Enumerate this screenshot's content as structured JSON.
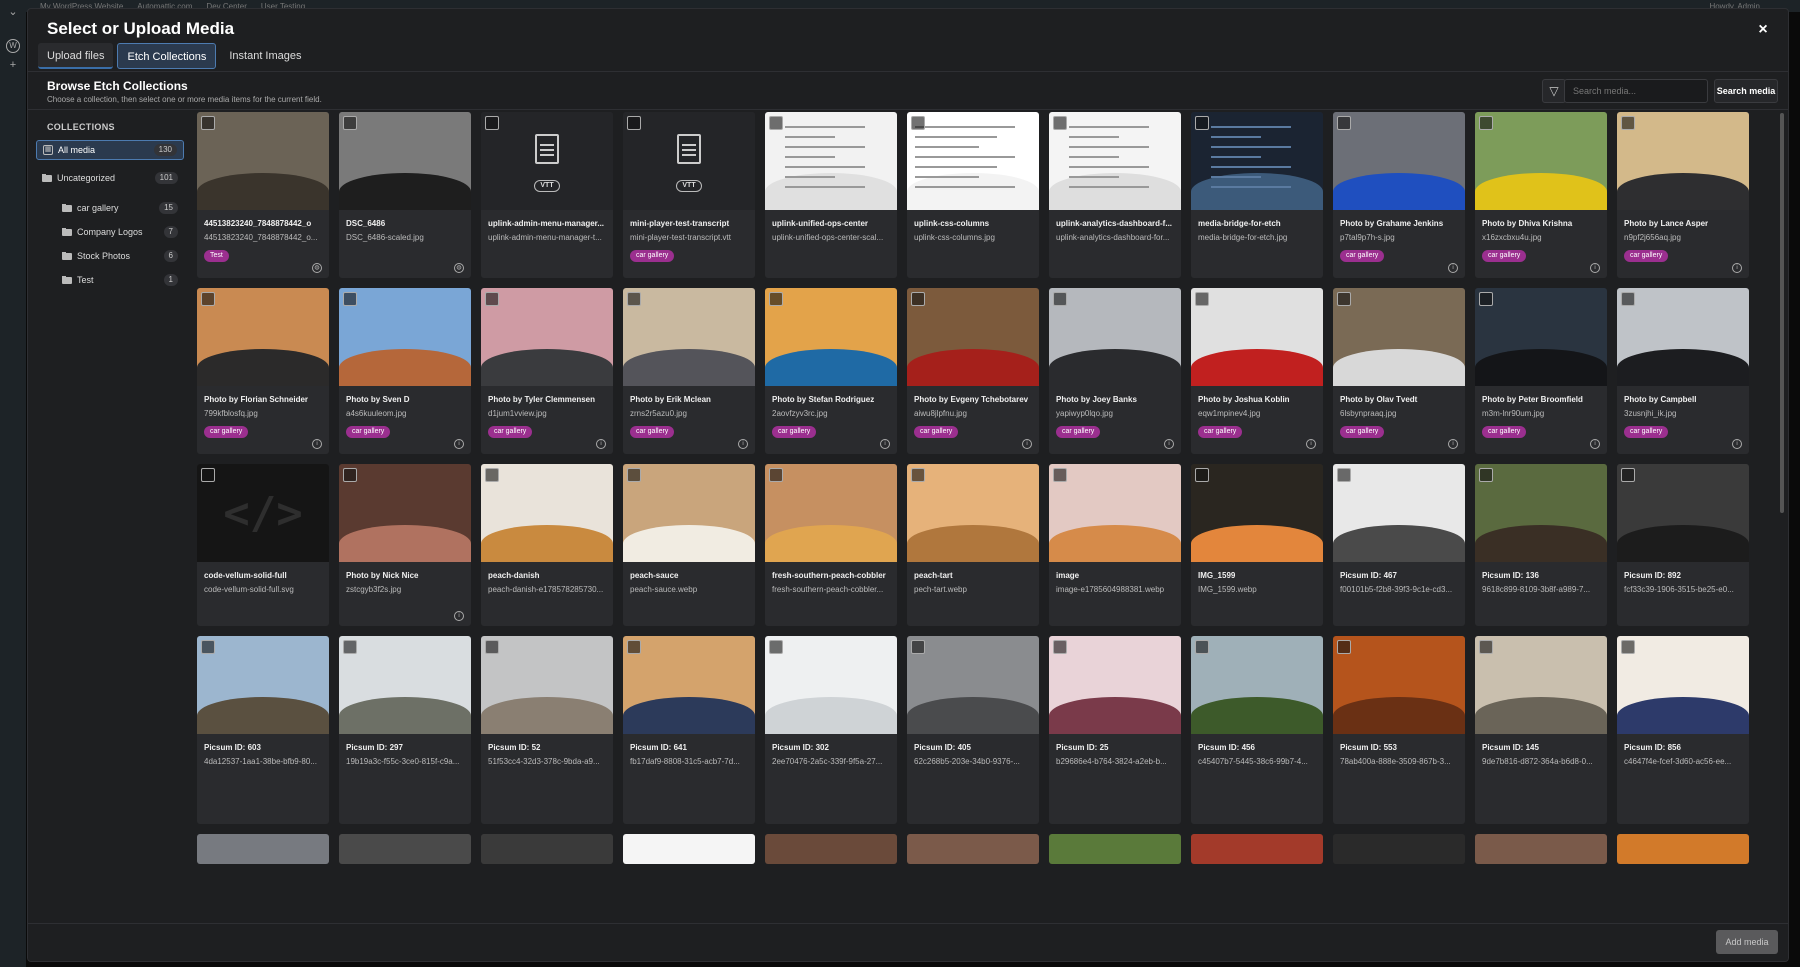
{
  "wp_bar": {
    "left": [
      "My WordPress Website",
      "Automattic.com",
      "Dev Center",
      "User Testing"
    ],
    "right": "Howdy, Admin"
  },
  "modal": {
    "title": "Select or Upload Media",
    "close_label": "×"
  },
  "tabs": [
    {
      "label": "Upload files"
    },
    {
      "label": "Etch Collections"
    },
    {
      "label": "Instant Images"
    }
  ],
  "browse": {
    "title": "Browse Etch Collections",
    "subtitle": "Choose a collection, then select one or more media items for the current field."
  },
  "search": {
    "placeholder": "Search media...",
    "button": "Search media",
    "filter_icon": "filter-icon"
  },
  "collections": {
    "heading": "COLLECTIONS",
    "items": [
      {
        "label": "All media",
        "count": "130",
        "selected": true,
        "sub": false
      },
      {
        "label": "Uncategorized",
        "count": "101",
        "sub": false
      },
      {
        "label": "car gallery",
        "count": "15",
        "sub": true
      },
      {
        "label": "Company Logos",
        "count": "7",
        "sub": true
      },
      {
        "label": "Stock Photos",
        "count": "6",
        "sub": true
      },
      {
        "label": "Test",
        "count": "1",
        "sub": true
      }
    ]
  },
  "media": [
    {
      "name": "44513823240_7848878442_o",
      "file": "44513823240_7848878442_o...",
      "tag": "Test",
      "icon": "globe",
      "c1": "#6b6356",
      "c2": "#3a342c"
    },
    {
      "name": "DSC_6486",
      "file": "DSC_6486-scaled.jpg",
      "icon": "globe",
      "c1": "#7a7a7a",
      "c2": "#1e1e1e"
    },
    {
      "name": "uplink-admin-menu-manager...",
      "file": "uplink-admin-menu-manager-t...",
      "kind": "vtt",
      "vtt": "VTT"
    },
    {
      "name": "mini-player-test-transcript",
      "file": "mini-player-test-transcript.vtt",
      "tag": "car gallery",
      "kind": "vtt",
      "vtt": "VTT"
    },
    {
      "name": "uplink-unified-ops-center",
      "file": "uplink-unified-ops-center-scal...",
      "kind": "ui",
      "c1": "#f2f2f2",
      "c2": "#e0e0e0"
    },
    {
      "name": "uplink-css-columns",
      "file": "uplink-css-columns.jpg",
      "kind": "text",
      "c1": "#ffffff",
      "c2": "#f3f3f3"
    },
    {
      "name": "uplink-analytics-dashboard-f...",
      "file": "uplink-analytics-dashboard-for...",
      "kind": "ui",
      "c1": "#f4f4f4",
      "c2": "#dedede"
    },
    {
      "name": "media-bridge-for-etch",
      "file": "media-bridge-for-etch.jpg",
      "kind": "dark",
      "c1": "#1b2432",
      "c2": "#3c5a7a"
    },
    {
      "name": "Photo by Grahame Jenkins",
      "file": "p7tal9p7h-s.jpg",
      "tag": "car gallery",
      "icon": "info",
      "c1": "#6c6f77",
      "c2": "#1f4fbf"
    },
    {
      "name": "Photo by Dhiva Krishna",
      "file": "x16zxcbxu4u.jpg",
      "tag": "car gallery",
      "icon": "info",
      "c1": "#7d9c5a",
      "c2": "#e0c21a"
    },
    {
      "name": "Photo by Lance Asper",
      "file": "n9pf2j656aq.jpg",
      "tag": "car gallery",
      "icon": "info",
      "c1": "#d3b98a",
      "c2": "#2e2e30"
    },
    {
      "name": "Photo by Florian Schneider",
      "file": "799kfblosfq.jpg",
      "tag": "car gallery",
      "icon": "info",
      "c1": "#c98a52",
      "c2": "#2b2a2a"
    },
    {
      "name": "Photo by Sven D",
      "file": "a4s6kuuleom.jpg",
      "tag": "car gallery",
      "icon": "info",
      "c1": "#7aa6d6",
      "c2": "#b5673a"
    },
    {
      "name": "Photo by Tyler Clemmensen",
      "file": "d1jum1vview.jpg",
      "tag": "car gallery",
      "icon": "info",
      "c1": "#cf9ba4",
      "c2": "#3a3b3e"
    },
    {
      "name": "Photo by Erik Mclean",
      "file": "zrns2r5azu0.jpg",
      "tag": "car gallery",
      "icon": "info",
      "c1": "#c9b9a0",
      "c2": "#54545a"
    },
    {
      "name": "Photo by Stefan Rodriguez",
      "file": "2aovfzyv3rc.jpg",
      "tag": "car gallery",
      "icon": "info",
      "c1": "#e3a34a",
      "c2": "#1f6aa5"
    },
    {
      "name": "Photo by Evgeny Tchebotarev",
      "file": "aiwu8jlpfnu.jpg",
      "tag": "car gallery",
      "icon": "info",
      "c1": "#7c5a3c",
      "c2": "#a5201b"
    },
    {
      "name": "Photo by Joey Banks",
      "file": "yapiwyp0lqo.jpg",
      "tag": "car gallery",
      "icon": "info",
      "c1": "#b5b8bd",
      "c2": "#2a2b2e"
    },
    {
      "name": "Photo by Joshua Koblin",
      "file": "eqw1mpinev4.jpg",
      "tag": "car gallery",
      "icon": "info",
      "c1": "#e0e0e0",
      "c2": "#c1201f"
    },
    {
      "name": "Photo by Olav Tvedt",
      "file": "6lsbynpraaq.jpg",
      "tag": "car gallery",
      "icon": "info",
      "c1": "#7a6a55",
      "c2": "#d8d8d8"
    },
    {
      "name": "Photo by Peter Broomfield",
      "file": "m3m-lnr90um.jpg",
      "tag": "car gallery",
      "icon": "info",
      "c1": "#2a3440",
      "c2": "#141518"
    },
    {
      "name": "Photo by Campbell",
      "file": "3zusnjhi_ik.jpg",
      "tag": "car gallery",
      "icon": "info",
      "c1": "#bfc3c8",
      "c2": "#1c1d20"
    },
    {
      "name": "code-vellum-solid-full",
      "file": "code-vellum-solid-full.svg",
      "kind": "code",
      "code": "</>"
    },
    {
      "name": "Photo by Nick Nice",
      "file": "zstcgyb3f2s.jpg",
      "icon": "info",
      "c1": "#5a3a30",
      "c2": "#b07260"
    },
    {
      "name": "peach-danish",
      "file": "peach-danish-e178578285730...",
      "c1": "#e9e3da",
      "c2": "#c98a3f"
    },
    {
      "name": "peach-sauce",
      "file": "peach-sauce.webp",
      "c1": "#c9a57c",
      "c2": "#f1ece2"
    },
    {
      "name": "fresh-southern-peach-cobbler",
      "file": "fresh-southern-peach-cobbler...",
      "c1": "#c69061",
      "c2": "#e0a550"
    },
    {
      "name": "peach-tart",
      "file": "pech-tart.webp",
      "c1": "#e6b27a",
      "c2": "#b0773d"
    },
    {
      "name": "image",
      "file": "image-e1785604988381.webp",
      "c1": "#e3c9c3",
      "c2": "#d68b4a"
    },
    {
      "name": "IMG_1599",
      "file": "IMG_1599.webp",
      "c1": "#2a2620",
      "c2": "#e3863c"
    },
    {
      "name": "Picsum ID: 467",
      "file": "f00101b5-f2b8-39f3-9c1e-cd3...",
      "c1": "#e8e8e8",
      "c2": "#4a4a4a"
    },
    {
      "name": "Picsum ID: 136",
      "file": "9618c899-8109-3b8f-a989-7...",
      "c1": "#5a6a3f",
      "c2": "#3a2f25"
    },
    {
      "name": "Picsum ID: 892",
      "file": "fcf33c39-1906-3515-be25-e0...",
      "c1": "#3a3a3a",
      "c2": "#1c1c1c"
    },
    {
      "name": "Picsum ID: 603",
      "file": "4da12537-1aa1-38be-bfb9-80...",
      "c1": "#9cb6cf",
      "c2": "#5a5040"
    },
    {
      "name": "Picsum ID: 297",
      "file": "19b19a3c-f55c-3ce0-815f-c9a...",
      "c1": "#d9dde0",
      "c2": "#6d7066"
    },
    {
      "name": "Picsum ID: 52",
      "file": "51f53cc4-32d3-378c-9bda-a9...",
      "c1": "#c3c4c5",
      "c2": "#8a7f72"
    },
    {
      "name": "Picsum ID: 641",
      "file": "fb17daf9-8808-31c5-acb7-7d...",
      "c1": "#d4a36c",
      "c2": "#2c3a5a"
    },
    {
      "name": "Picsum ID: 302",
      "file": "2ee70476-2a5c-339f-9f5a-27...",
      "c1": "#eef0f1",
      "c2": "#cfd3d6"
    },
    {
      "name": "Picsum ID: 405",
      "file": "62c268b5-203e-34b0-9376-...",
      "c1": "#8a8c8f",
      "c2": "#4a4b4d"
    },
    {
      "name": "Picsum ID: 25",
      "file": "b29686e4-b764-3824-a2eb-b...",
      "c1": "#e9d3d8",
      "c2": "#7a3a4a"
    },
    {
      "name": "Picsum ID: 456",
      "file": "c45407b7-5445-38c6-99b7-4...",
      "c1": "#9fb0b8",
      "c2": "#3d5a2a"
    },
    {
      "name": "Picsum ID: 553",
      "file": "78ab400a-888e-3509-867b-3...",
      "c1": "#b5541c",
      "c2": "#6a3014"
    },
    {
      "name": "Picsum ID: 145",
      "file": "9de7b816-d872-364a-b6d8-0...",
      "c1": "#c9bfae",
      "c2": "#6a6458"
    },
    {
      "name": "Picsum ID: 856",
      "file": "c4647f4e-fcef-3d60-ac56-ee...",
      "c1": "#f1ebe3",
      "c2": "#2d3a6a"
    }
  ],
  "partial_row": [
    "#777a80",
    "#4a4a4a",
    "#3a3a3a",
    "#f5f5f5",
    "#6a4a3a",
    "#7b5a4a",
    "#5a7a3a",
    "#a33a2a",
    "#2a2a2a",
    "#7a5a4a",
    "#d27a2a"
  ],
  "footer": {
    "add_button": "Add media"
  }
}
